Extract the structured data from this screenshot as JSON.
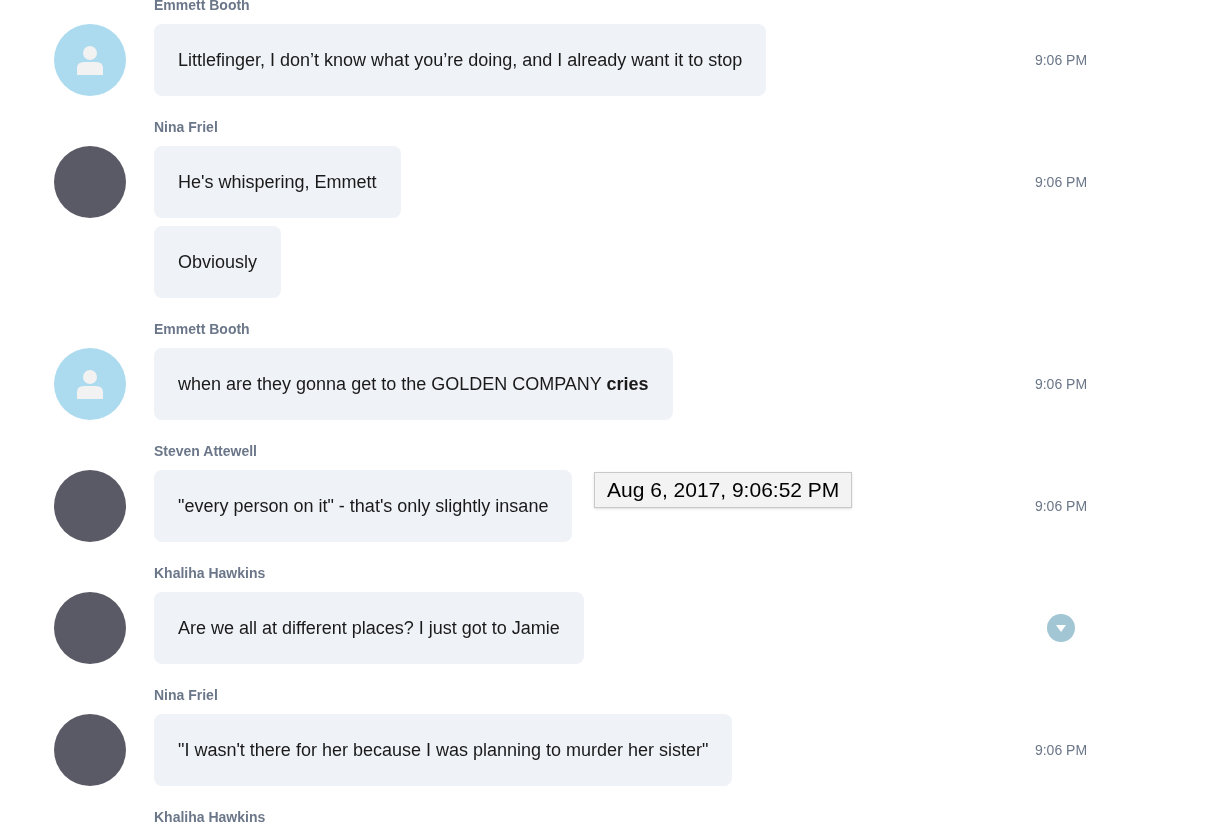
{
  "groups": [
    {
      "author": "Emmett Booth",
      "default_avatar": true,
      "messages": [
        {
          "kind": "text",
          "text": "Littlefinger, I don’t know what you’re doing, and I already want it to stop",
          "time": "9:06 PM",
          "show_menu": false
        }
      ]
    },
    {
      "author": "Nina Friel",
      "default_avatar": false,
      "messages": [
        {
          "kind": "text",
          "text": "He's whispering, Emmett",
          "time": "9:06 PM",
          "show_menu": false
        },
        {
          "kind": "text",
          "text": "Obviously",
          "show_menu": false
        }
      ]
    },
    {
      "author": "Emmett Booth",
      "default_avatar": true,
      "messages": [
        {
          "kind": "text",
          "text": "when are they gonna get to the GOLDEN COMPANY **cries**",
          "time": "9:06 PM",
          "show_menu": false
        }
      ]
    },
    {
      "author": "Steven Attewell",
      "default_avatar": false,
      "messages": [
        {
          "kind": "text",
          "text": "\"every person on it\" - that's only slightly insane",
          "time": "9:06 PM",
          "show_menu": false,
          "tooltip": "Aug 6, 2017, 9:06:52 PM"
        }
      ]
    },
    {
      "author": "Khaliha Hawkins",
      "default_avatar": false,
      "messages": [
        {
          "kind": "text",
          "text": "Are we all at different places? I just got to Jamie",
          "show_menu": true
        }
      ]
    },
    {
      "author": "Nina Friel",
      "default_avatar": false,
      "messages": [
        {
          "kind": "text",
          "text": "\"I wasn't there for her because I was planning to murder her sister\"",
          "time": "9:06 PM",
          "show_menu": false
        }
      ]
    },
    {
      "author": "Khaliha Hawkins"
    }
  ]
}
